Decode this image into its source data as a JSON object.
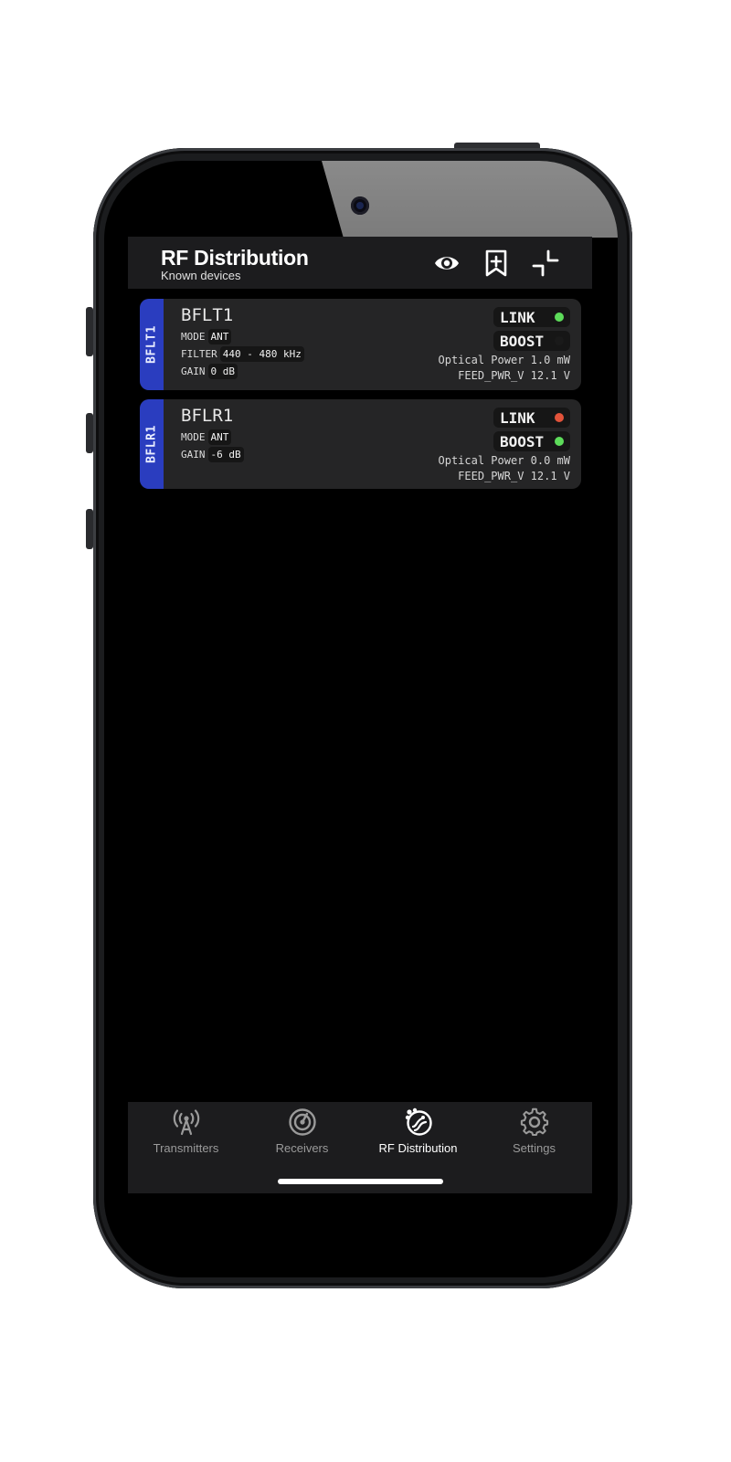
{
  "header": {
    "title": "RF Distribution",
    "subtitle": "Known devices",
    "icons": [
      "eye-icon",
      "bookmark-add-icon",
      "collapse-icon"
    ]
  },
  "devices": [
    {
      "tab_label": "BFLT1",
      "name": "BFLT1",
      "props": [
        {
          "key": "MODE",
          "value": "ANT"
        },
        {
          "key": "FILTER",
          "value": "440 - 480 kHz"
        },
        {
          "key": "GAIN",
          "value": "0 dB"
        }
      ],
      "link": {
        "label": "LINK",
        "color": "#5ddc5a"
      },
      "boost": {
        "label": "BOOST",
        "color": "#1a1a1a"
      },
      "optical_power": "Optical Power 1.0 mW",
      "feed_pwr": "FEED_PWR_V 12.1 V"
    },
    {
      "tab_label": "BFLR1",
      "name": "BFLR1",
      "props": [
        {
          "key": "MODE",
          "value": "ANT"
        },
        {
          "key": "GAIN",
          "value": "-6 dB"
        }
      ],
      "link": {
        "label": "LINK",
        "color": "#e2533a"
      },
      "boost": {
        "label": "BOOST",
        "color": "#5ddc5a"
      },
      "optical_power": "Optical Power 0.0 mW",
      "feed_pwr": "FEED_PWR_V 12.1 V"
    }
  ],
  "tabs": [
    {
      "label": "Transmitters",
      "icon": "antenna-icon",
      "active": false
    },
    {
      "label": "Receivers",
      "icon": "receiver-icon",
      "active": false
    },
    {
      "label": "RF Distribution",
      "icon": "rf-distribution-icon",
      "active": true
    },
    {
      "label": "Settings",
      "icon": "gear-icon",
      "active": false
    }
  ],
  "colors": {
    "accent_tab": "#2a3dbf",
    "led_green": "#5ddc5a",
    "led_red": "#e2533a",
    "card_bg": "#252526",
    "bar_bg": "#1c1c1e"
  }
}
